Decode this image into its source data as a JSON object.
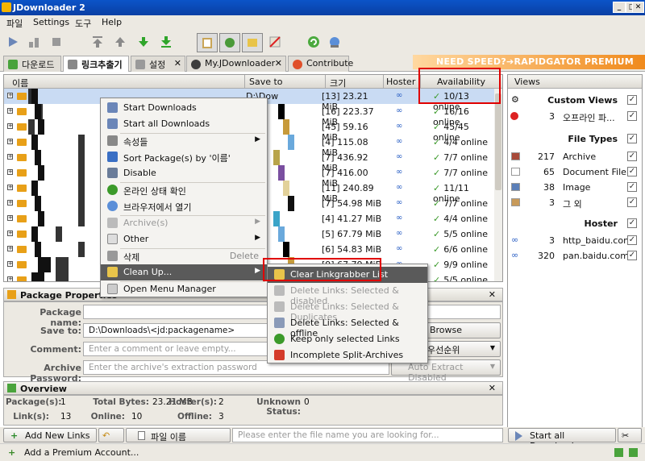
{
  "window": {
    "title": "JDownloader 2"
  },
  "menu": [
    "파일",
    "Settings",
    "도구",
    "Help"
  ],
  "tabs": [
    {
      "label": "다운로드",
      "closable": false
    },
    {
      "label": "링크추출기",
      "closable": false,
      "active": true
    },
    {
      "label": "설정",
      "closable": true
    },
    {
      "label": "My.JDownloader",
      "closable": true
    },
    {
      "label": "Contribute",
      "closable": false
    }
  ],
  "banner": "NEED SPEED?➔RAPIDGATOR PREMIUM",
  "grid": {
    "columns": {
      "name": "이름",
      "save_to": "Save to",
      "size": "크기",
      "hoster": "Hoster",
      "availability": "Availability"
    },
    "first_save_to": "D:\\Dow",
    "rows": [
      {
        "size": "[13] 23.21 MiB",
        "availability": "10/13 online"
      },
      {
        "size": "[16] 223.37 MiB",
        "availability": "16/16 online"
      },
      {
        "size": "[45] 59.16 MiB",
        "availability": "45/45 online"
      },
      {
        "size": "[4] 115.08 MiB",
        "availability": "4/4 online"
      },
      {
        "size": "[7] 436.92 MiB",
        "availability": "7/7 online"
      },
      {
        "size": "[7] 416.00 MiB",
        "availability": "7/7 online"
      },
      {
        "size": "[11] 240.89 MiB",
        "availability": "11/11 online"
      },
      {
        "size": "[7] 54.98 MiB",
        "availability": "7/7 online"
      },
      {
        "size": "[4] 41.27 MiB",
        "availability": "4/4 online"
      },
      {
        "size": "[5] 67.79 MiB",
        "availability": "5/5 online"
      },
      {
        "size": "[6] 54.83 MiB",
        "availability": "6/6 online"
      },
      {
        "size": "[9] 67.79 MiB",
        "availability": "9/9 online"
      },
      {
        "size": "[5] 20.31 MiB",
        "availability": "5/5 online"
      }
    ]
  },
  "context_menu": {
    "items": [
      {
        "label": "Start Downloads"
      },
      {
        "label": "Start all Downloads"
      },
      {
        "label": "속성들"
      },
      {
        "label": "Sort Package(s) by '이름'"
      },
      {
        "label": "Disable"
      },
      {
        "label": "온라인 상태 확인"
      },
      {
        "label": "브라우저에서 열기"
      },
      {
        "label": "Archive(s)"
      },
      {
        "label": "Other"
      },
      {
        "label": "삭제",
        "shortcut": "Delete"
      },
      {
        "label": "Clean Up..."
      },
      {
        "label": "Open Menu Manager"
      }
    ]
  },
  "submenu": {
    "items": [
      {
        "label": "Clear Linkgrabber List"
      },
      {
        "label": "Delete Links: Selected & disabled"
      },
      {
        "label": "Delete Links: Selected & Duplicates"
      },
      {
        "label": "Delete Links: Selected & offline"
      },
      {
        "label": "Keep only selected Links"
      },
      {
        "label": "Incomplete Split-Archives"
      }
    ]
  },
  "package_properties": {
    "title": "Package Properties",
    "name_label": "Package name:",
    "save_to_label": "Save to:",
    "save_to_value": "D:\\Downloads\\<jd:packagename>",
    "browse": "Browse",
    "comment_label": "Comment:",
    "comment_placeholder": "Enter a comment or leave empty...",
    "priority": "우선순위",
    "password_label": "Archive Password:",
    "password_placeholder": "Enter the archive's extraction password",
    "auto_extract": "Auto Extract Disabled"
  },
  "overview": {
    "title": "Overview",
    "packages_label": "Package(s):",
    "packages": "1",
    "bytes_label": "Total Bytes:",
    "bytes": "23.21 MB",
    "hosters_label": "Hoster(s):",
    "hosters": "2",
    "unknown_label": "Unknown Status:",
    "unknown": "0",
    "links_label": "Link(s):",
    "links": "13",
    "online_label": "Online:",
    "online": "10",
    "offline_label": "Offline:",
    "offline": "3"
  },
  "views": {
    "title": "Views",
    "custom_views": "Custom Views",
    "offline_count": "3",
    "offline_label": "오프라인 파...",
    "file_types": "File Types",
    "types": [
      {
        "count": "217",
        "label": "Archive"
      },
      {
        "count": "65",
        "label": "Document File"
      },
      {
        "count": "38",
        "label": "Image"
      },
      {
        "count": "3",
        "label": "그 외"
      }
    ],
    "hoster": "Hoster",
    "hosters": [
      {
        "count": "3",
        "label": "http_baidu.com"
      },
      {
        "count": "320",
        "label": "pan.baidu.com"
      }
    ]
  },
  "bottom": {
    "add_links": "Add New Links",
    "filename_sort": "파일 이름",
    "search_placeholder": "Please enter the file name you are looking for...",
    "start_all": "Start all Downloads"
  },
  "status": {
    "premium": "Add a Premium Account..."
  },
  "colors": {
    "highlight": "#e00000",
    "selection": "#c9dbf3",
    "menu_hover": "#5a5a5a"
  }
}
